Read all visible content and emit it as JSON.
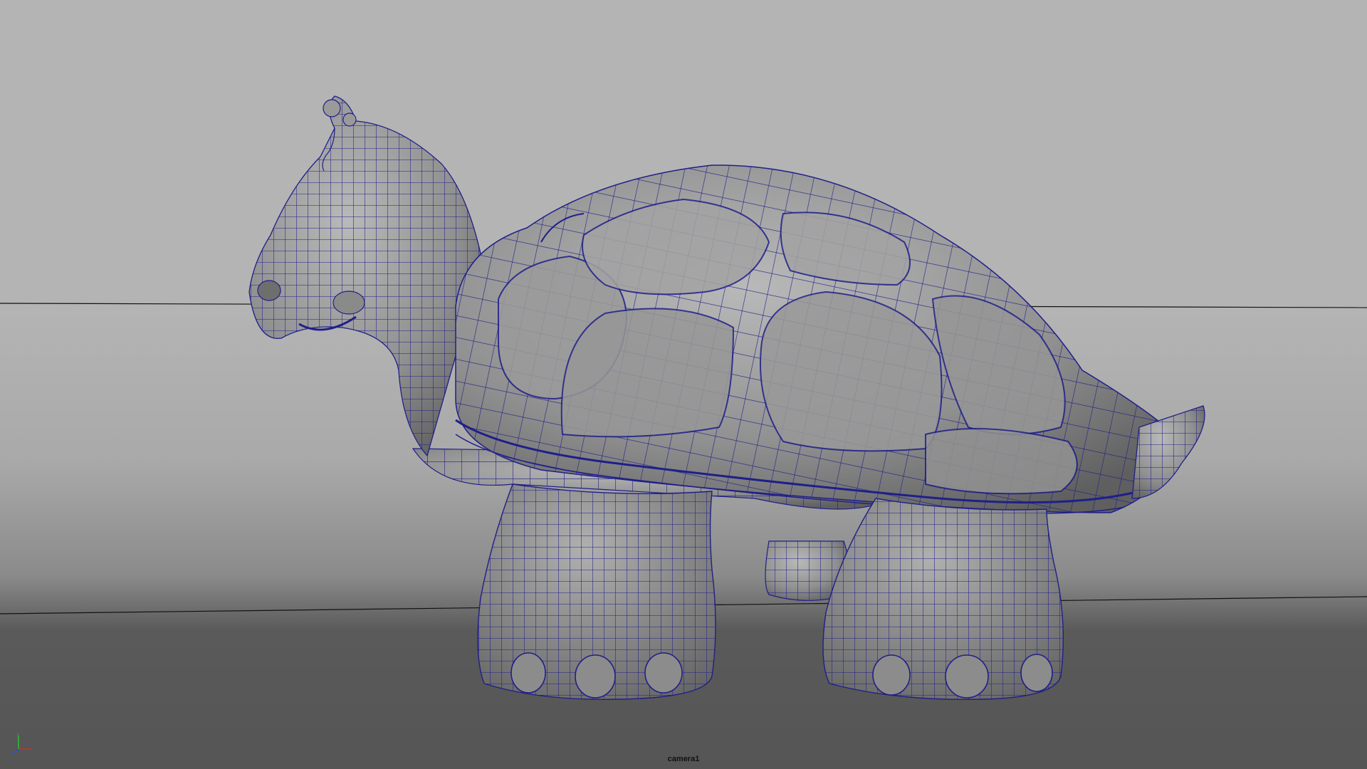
{
  "viewport": {
    "camera_name": "camera1",
    "shading": "smooth-shade-with-wireframe",
    "subject": "tortoise"
  },
  "axis_gizmo": {
    "icon": "xyz-axis-icon",
    "colors": {
      "x": "#d62a2a",
      "y": "#2fbf2f",
      "z": "#2a4fd6"
    }
  },
  "colors": {
    "background_top": "#b4b4b4",
    "background_bottom": "#555555",
    "mesh_fill": "#8e8e8e",
    "wireframe": "#1f1f8a",
    "ground_line": "#111111"
  }
}
